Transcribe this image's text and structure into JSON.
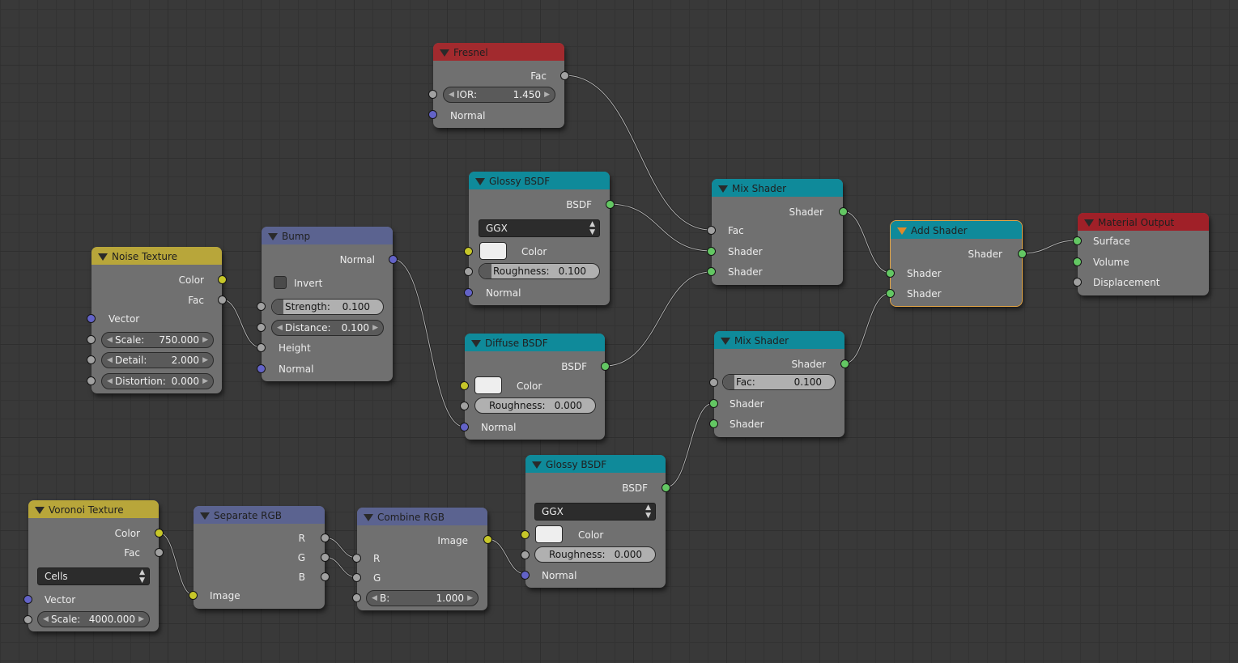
{
  "colors": {
    "socket_grey": "#a1a1a1",
    "socket_yellow": "#c7c729",
    "socket_green": "#63c763",
    "socket_blue": "#6363c7",
    "link": "#1e1e1e",
    "active_outline": "#e3a546"
  },
  "nodes": {
    "fresnel": {
      "title": "Fresnel",
      "out_fac": "Fac",
      "ior_label": "IOR:",
      "ior_value": "1.450",
      "normal": "Normal"
    },
    "glossy1": {
      "title": "Glossy BSDF",
      "out_bsdf": "BSDF",
      "distribution": "GGX",
      "color": "Color",
      "roughness_label": "Roughness:",
      "roughness_value": "0.100",
      "roughness_fraction": 0.1,
      "normal": "Normal"
    },
    "mix1": {
      "title": "Mix Shader",
      "out_shader": "Shader",
      "fac": "Fac",
      "shader_a": "Shader",
      "shader_b": "Shader"
    },
    "add": {
      "title": "Add Shader",
      "out_shader": "Shader",
      "shader_a": "Shader",
      "shader_b": "Shader"
    },
    "output": {
      "title": "Material Output",
      "surface": "Surface",
      "volume": "Volume",
      "displacement": "Displacement"
    },
    "noise": {
      "title": "Noise Texture",
      "out_color": "Color",
      "out_fac": "Fac",
      "vector": "Vector",
      "scale_label": "Scale:",
      "scale_value": "750.000",
      "detail_label": "Detail:",
      "detail_value": "2.000",
      "distortion_label": "Distortion:",
      "distortion_value": "0.000"
    },
    "bump": {
      "title": "Bump",
      "out_normal": "Normal",
      "invert": "Invert",
      "invert_checked": false,
      "strength_label": "Strength:",
      "strength_value": "0.100",
      "strength_fraction": 0.1,
      "distance_label": "Distance:",
      "distance_value": "0.100",
      "height": "Height",
      "normal": "Normal"
    },
    "diffuse": {
      "title": "Diffuse BSDF",
      "out_bsdf": "BSDF",
      "color": "Color",
      "roughness_label": "Roughness:",
      "roughness_value": "0.000",
      "roughness_fraction": 0.0,
      "normal": "Normal"
    },
    "mix2": {
      "title": "Mix Shader",
      "out_shader": "Shader",
      "fac_label": "Fac:",
      "fac_value": "0.100",
      "fac_fraction": 0.1,
      "shader_a": "Shader",
      "shader_b": "Shader"
    },
    "voronoi": {
      "title": "Voronoi Texture",
      "out_color": "Color",
      "out_fac": "Fac",
      "coloring": "Cells",
      "vector": "Vector",
      "scale_label": "Scale:",
      "scale_value": "4000.000"
    },
    "separate": {
      "title": "Separate RGB",
      "out_r": "R",
      "out_g": "G",
      "out_b": "B",
      "image": "Image"
    },
    "combine": {
      "title": "Combine RGB",
      "out_image": "Image",
      "r": "R",
      "g": "G",
      "b_label": "B:",
      "b_value": "1.000"
    },
    "glossy2": {
      "title": "Glossy BSDF",
      "out_bsdf": "BSDF",
      "distribution": "GGX",
      "color": "Color",
      "roughness_label": "Roughness:",
      "roughness_value": "0.000",
      "roughness_fraction": 0.0,
      "normal": "Normal"
    }
  }
}
